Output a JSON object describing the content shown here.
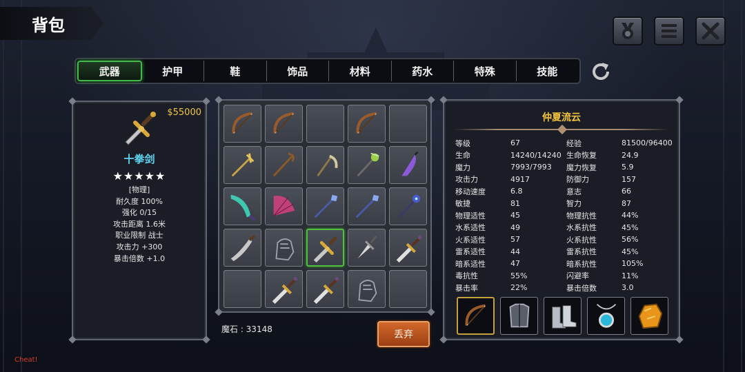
{
  "title": "背包",
  "top_buttons": [
    "medal-icon",
    "menu-icon",
    "close-icon"
  ],
  "tabs": [
    {
      "label": "武器",
      "active": true
    },
    {
      "label": "护甲",
      "active": false
    },
    {
      "label": "鞋",
      "active": false
    },
    {
      "label": "饰品",
      "active": false
    },
    {
      "label": "材料",
      "active": false
    },
    {
      "label": "药水",
      "active": false
    },
    {
      "label": "特殊",
      "active": false
    },
    {
      "label": "技能",
      "active": false
    }
  ],
  "item": {
    "price": "$55000",
    "icon": "cross-sword-icon",
    "name": "十拳剑",
    "stars": "★★★★★",
    "lines": [
      "[物理]",
      "耐久度 100%",
      "强化 0/15",
      "攻击距离  1.6米",
      "职业限制  战士",
      "攻击力  +300",
      "暴击倍数  +1.0"
    ]
  },
  "inventory": [
    "bow-icon",
    "bow-icon",
    "",
    "bow-icon",
    "",
    "golden-staff-icon",
    "wooden-staff-icon",
    "scythe-icon",
    "nature-staff-icon",
    "purple-dagger-icon",
    "teal-scimitar-icon",
    "pink-fan-icon",
    "blue-spear-icon",
    "blue-spear-icon",
    "dark-staff-icon",
    "curved-sword-icon",
    "gauntlet-icon",
    "cross-sword-icon",
    "silver-dagger-icon",
    "short-sword-icon",
    "",
    "short-sword-icon",
    "short-sword-icon",
    "gauntlet-icon",
    ""
  ],
  "selected_index": 17,
  "currency": "魔石 : 33148",
  "discard_label": "丢弃",
  "character": {
    "name": "仲夏流云",
    "stats": [
      [
        "等级",
        "67",
        "经验",
        "81500/96400"
      ],
      [
        "生命",
        "14240/14240",
        "生命恢复",
        "24.9"
      ],
      [
        "魔力",
        "7993/7993",
        "魔力恢复",
        "5.9"
      ],
      [
        "攻击力",
        "4917",
        "防御力",
        "157"
      ],
      [
        "移动速度",
        "6.8",
        "意志",
        "66"
      ],
      [
        "敏捷",
        "81",
        "智力",
        "87"
      ],
      [
        "物理适性",
        "45",
        "物理抗性",
        "44%"
      ],
      [
        "水系适性",
        "49",
        "水系抗性",
        "45%"
      ],
      [
        "火系适性",
        "57",
        "火系抗性",
        "56%"
      ],
      [
        "雷系适性",
        "44",
        "雷系抗性",
        "45%"
      ],
      [
        "暗系适性",
        "47",
        "暗系抗性",
        "105%"
      ],
      [
        "毒抗性",
        "55%",
        "闪避率",
        "11%"
      ],
      [
        "暴击率",
        "22%",
        "暴击倍数",
        "3.0"
      ]
    ],
    "equipment": [
      "bow-icon",
      "chest-armor-icon",
      "boots-icon",
      "amulet-icon",
      "amber-ore-icon"
    ]
  },
  "cheat_label": "Cheat!",
  "colors": {
    "accent_gold": "#f2c341",
    "item_name": "#5fd4f2",
    "tab_active": "#43b84b",
    "discard": "#c9602a",
    "cheat": "#e23a2a"
  }
}
